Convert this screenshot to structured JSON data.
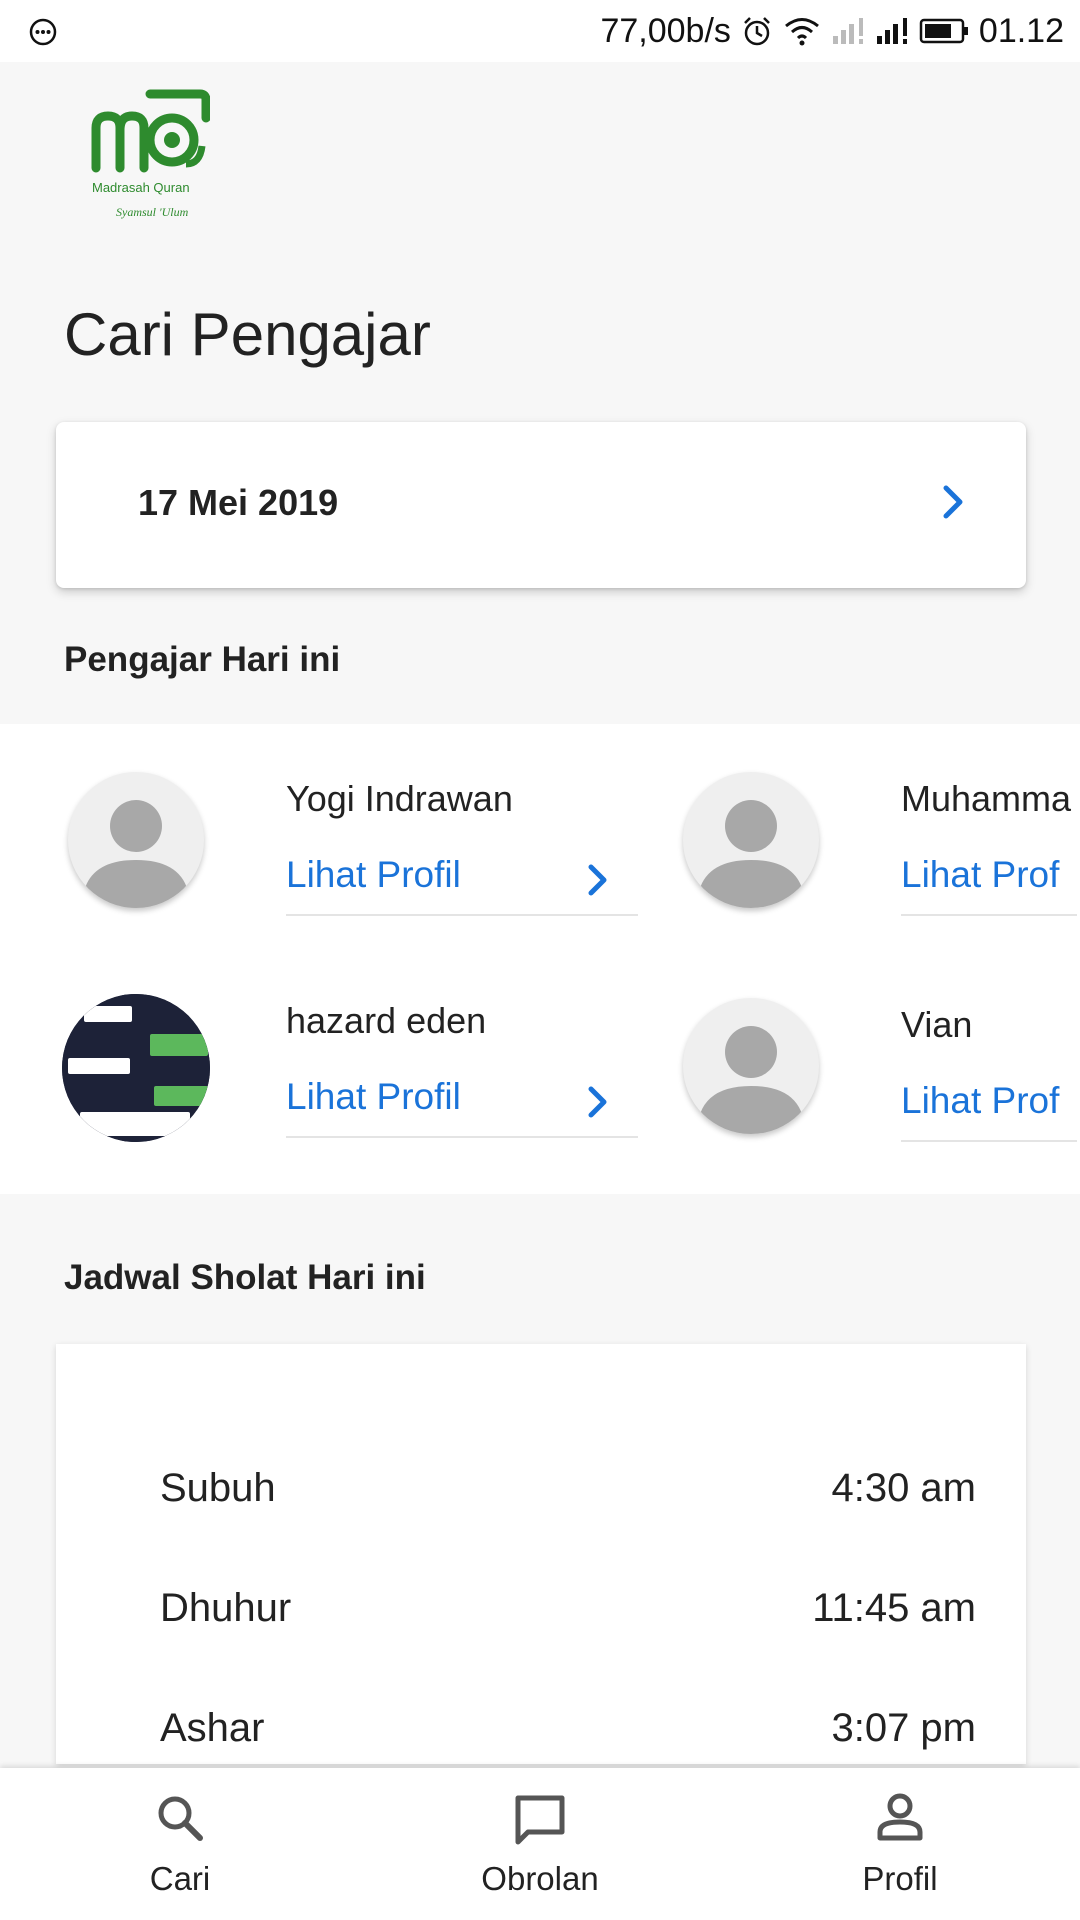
{
  "status_bar": {
    "network_speed": "77,00b/s",
    "time": "01.12",
    "icons": [
      "chat-bubble-icon",
      "alarm-icon",
      "wifi-icon",
      "signal-icon",
      "signal-icon",
      "battery-icon"
    ]
  },
  "logo": {
    "text_main": "MQ",
    "text_line1": "Madrasah Quran",
    "text_line2": "Syamsul 'Ulum",
    "color": "#2e8b2e"
  },
  "page": {
    "title": "Cari Pengajar"
  },
  "date_selector": {
    "date": "17 Mei 2019",
    "icon": "chevron-right-icon"
  },
  "teachers_section": {
    "heading": "Pengajar Hari ini",
    "teachers": [
      {
        "name": "Yogi Indrawan",
        "link_label": "Lihat Profil",
        "avatar": "default-avatar"
      },
      {
        "name": "Muhamma",
        "link_label": "Lihat Prof",
        "avatar": "default-avatar"
      },
      {
        "name": "hazard eden",
        "link_label": "Lihat Profil",
        "avatar": "photo-avatar"
      },
      {
        "name": "Vian",
        "link_label": "Lihat Prof",
        "avatar": "default-avatar"
      }
    ]
  },
  "prayer_section": {
    "heading": "Jadwal Sholat Hari ini",
    "times": [
      {
        "name": "Subuh",
        "time": "4:30 am"
      },
      {
        "name": "Dhuhur",
        "time": "11:45 am"
      },
      {
        "name": "Ashar",
        "time": "3:07 pm"
      }
    ]
  },
  "bottom_nav": {
    "items": [
      {
        "label": "Cari",
        "icon": "search-icon"
      },
      {
        "label": "Obrolan",
        "icon": "chat-icon"
      },
      {
        "label": "Profil",
        "icon": "person-icon"
      }
    ]
  },
  "colors": {
    "accent": "#1a73d9",
    "background": "#f7f7f7",
    "text": "#222222"
  }
}
